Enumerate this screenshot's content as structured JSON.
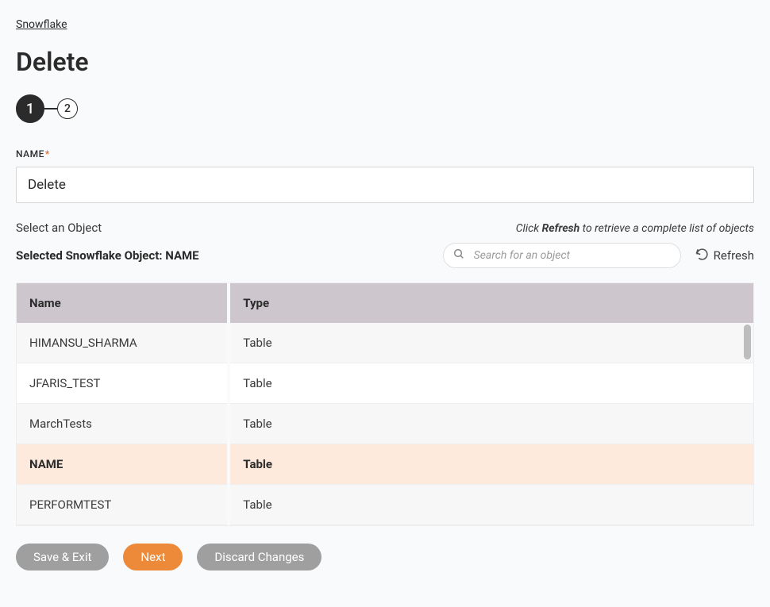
{
  "breadcrumb": "Snowflake",
  "pageTitle": "Delete",
  "stepper": {
    "step1": "1",
    "step2": "2"
  },
  "nameField": {
    "label": "NAME",
    "required": "*",
    "value": "Delete"
  },
  "selectObjectLabel": "Select an Object",
  "hint": {
    "pre": "Click ",
    "strong": "Refresh",
    "post": " to retrieve a complete list of objects"
  },
  "selected": {
    "prefix": "Selected Snowflake Object: ",
    "name": "NAME"
  },
  "search": {
    "placeholder": "Search for an object"
  },
  "refreshLabel": "Refresh",
  "table": {
    "headers": {
      "name": "Name",
      "type": "Type"
    },
    "rows": [
      {
        "name": "HIMANSU_SHARMA",
        "type": "Table",
        "style": "alt"
      },
      {
        "name": "JFARIS_TEST",
        "type": "Table",
        "style": "norm"
      },
      {
        "name": "MarchTests",
        "type": "Table",
        "style": "alt"
      },
      {
        "name": "NAME",
        "type": "Table",
        "style": "sel"
      },
      {
        "name": "PERFORMTEST",
        "type": "Table",
        "style": "alt"
      }
    ]
  },
  "buttons": {
    "saveExit": "Save & Exit",
    "next": "Next",
    "discard": "Discard Changes"
  }
}
